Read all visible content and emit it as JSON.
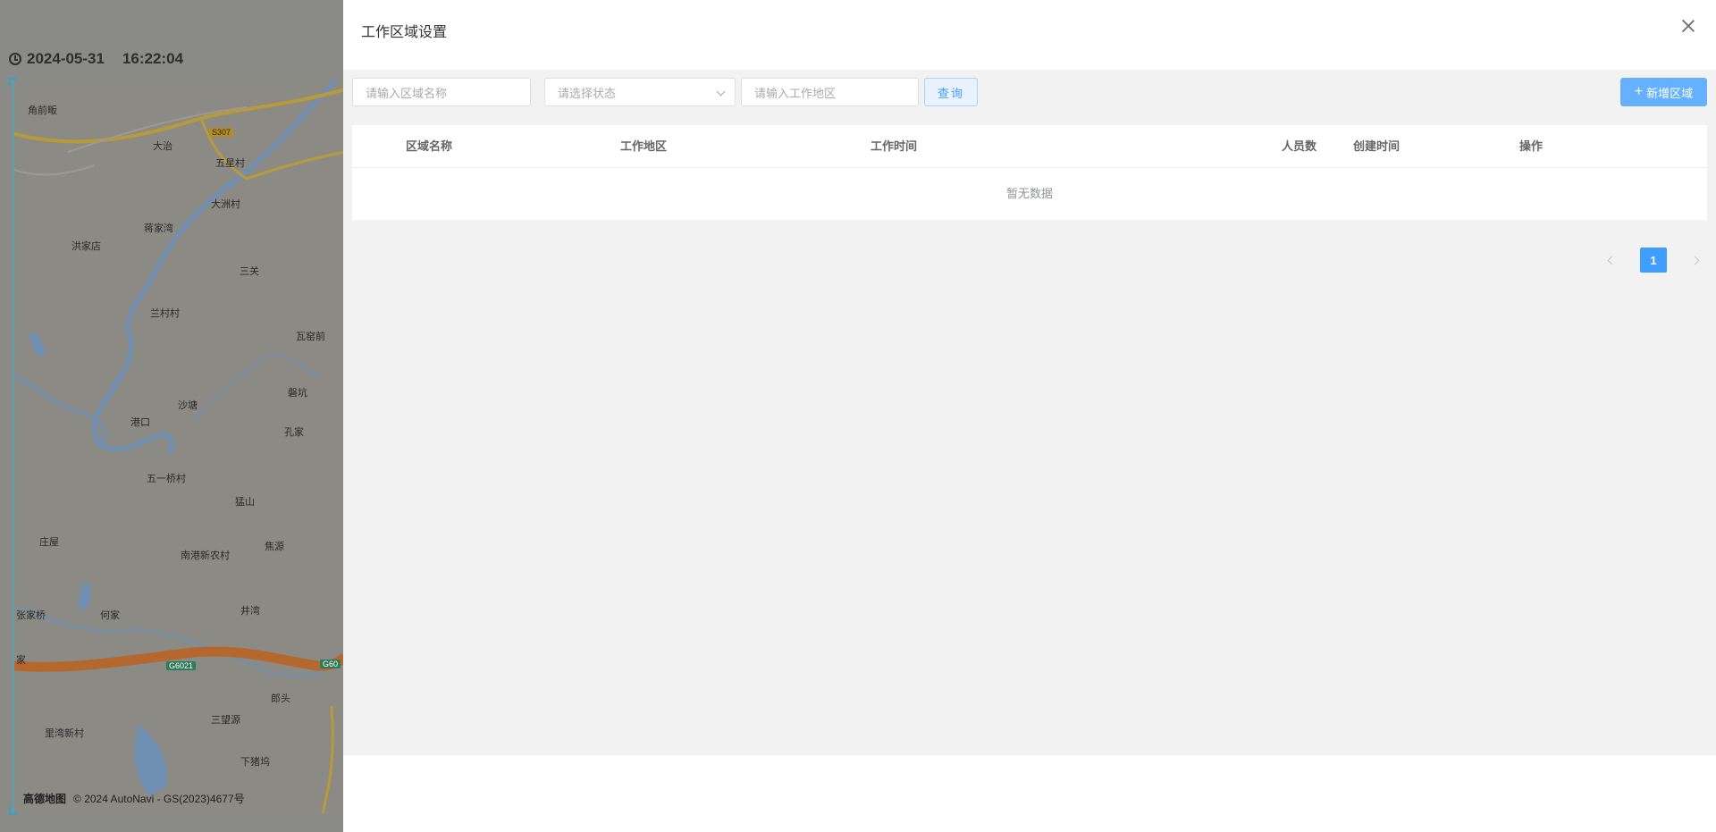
{
  "header": {
    "date": "2024-05-31",
    "time": "16:22:04"
  },
  "map": {
    "labels": [
      "角前畈",
      "大治",
      "五星村",
      "大洲村",
      "蒋家湾",
      "洪家店",
      "兰村村",
      "三关",
      "瓦窑前",
      "沙塘",
      "港口",
      "磐坑",
      "孔家",
      "五一桥村",
      "猛山",
      "庄屋",
      "南港新农村",
      "焦源",
      "井湾",
      "何家",
      "张家桥",
      "郎头",
      "三望源",
      "里湾新村",
      "下猪坞",
      "家"
    ],
    "road_badges": [
      "S307",
      "G6021",
      "G60"
    ],
    "footer_logo": "高德地图",
    "footer_copyright": "© 2024 AutoNavi - GS(2023)4677号"
  },
  "drawer": {
    "title": "工作区域设置",
    "filters": {
      "area_name_placeholder": "请输入区域名称",
      "status_placeholder": "请选择状态",
      "work_area_placeholder": "请输入工作地区"
    },
    "query_label": "查询",
    "add_label": "新增区域",
    "table": {
      "columns": [
        "区域名称",
        "工作地区",
        "工作时间",
        "人员数",
        "创建时间",
        "操作"
      ],
      "rows": [],
      "empty_text": "暂无数据"
    },
    "pagination": {
      "current_page": "1"
    }
  },
  "colors": {
    "primary": "#409eff",
    "primary_light": "#66b1ff",
    "body_bg": "#f2f2f2",
    "overlay": "#7d7d7d"
  }
}
